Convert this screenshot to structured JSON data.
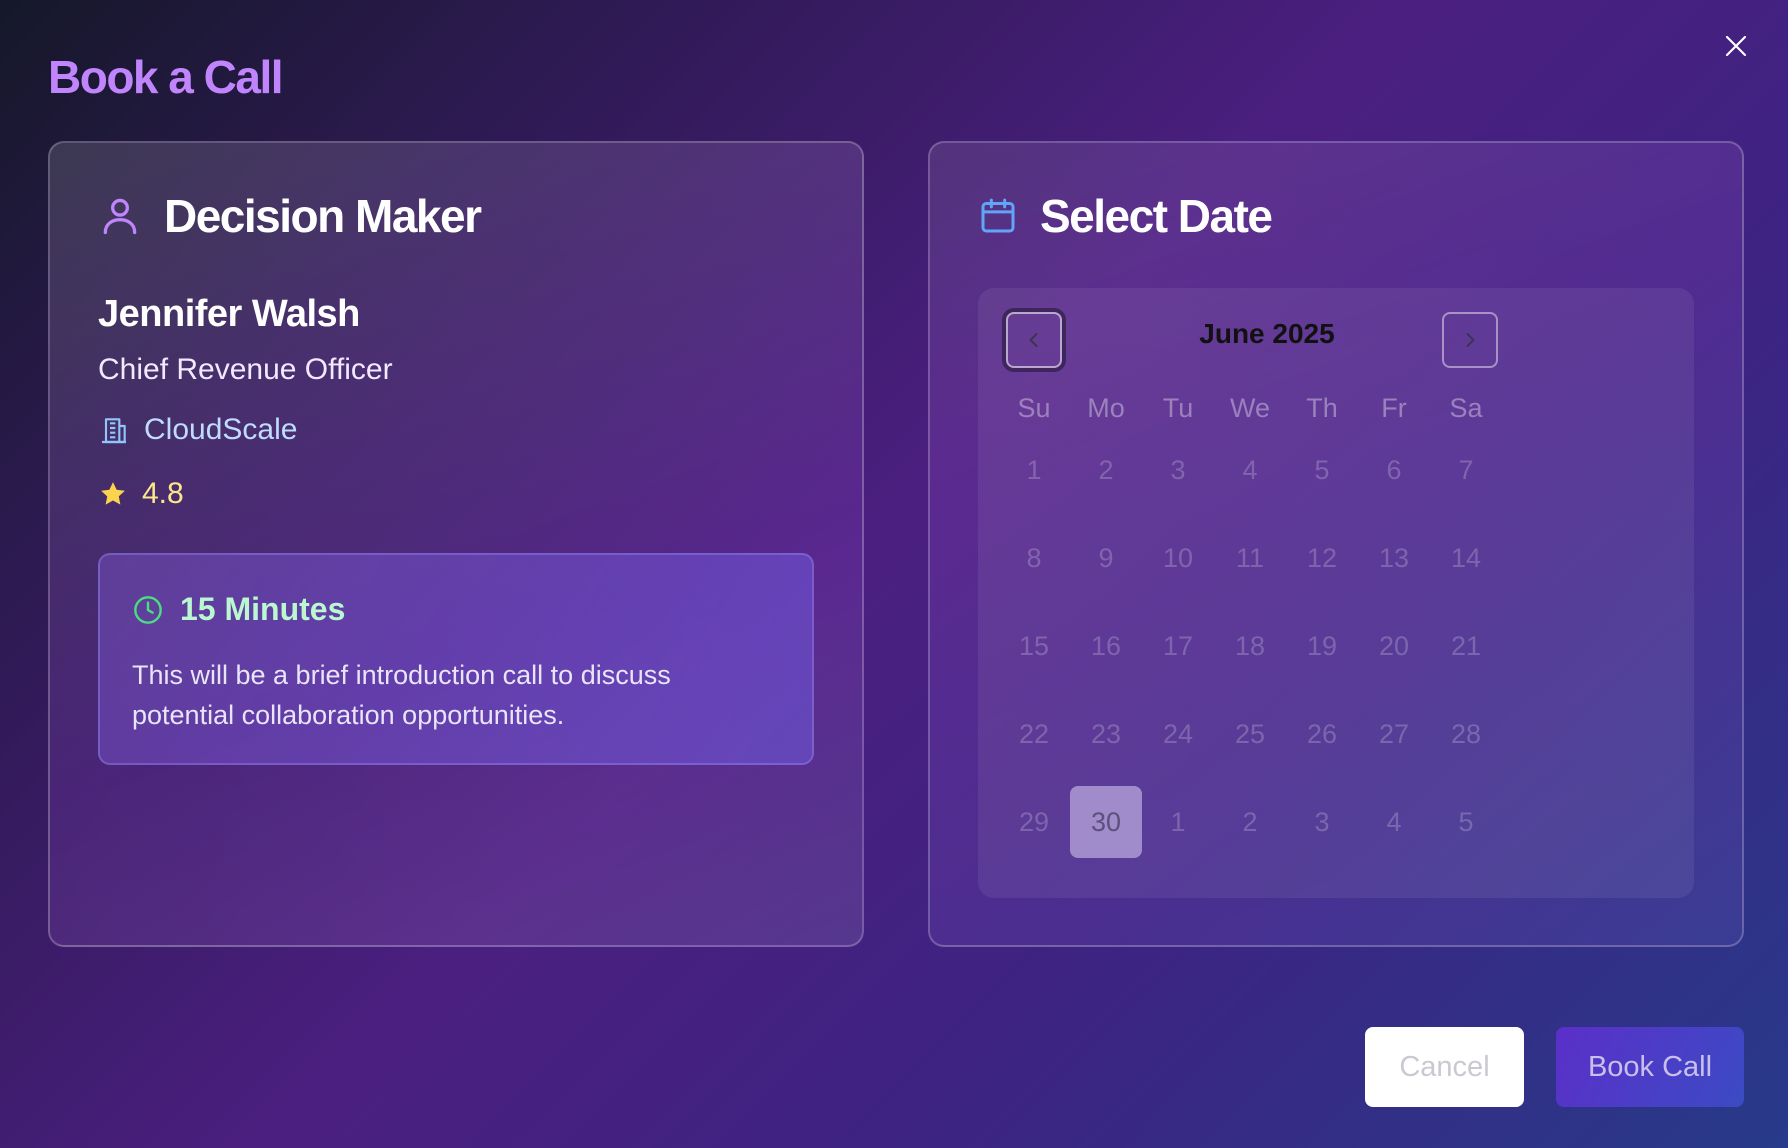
{
  "modal": {
    "title": "Book a Call"
  },
  "decision_maker": {
    "heading": "Decision Maker",
    "name": "Jennifer Walsh",
    "role": "Chief Revenue Officer",
    "company": "CloudScale",
    "rating": "4.8",
    "call": {
      "duration": "15 Minutes",
      "description": "This will be a brief introduction call to discuss potential collaboration opportunities."
    }
  },
  "date_picker": {
    "heading": "Select Date",
    "month_label": "June 2025",
    "weekdays": [
      "Su",
      "Mo",
      "Tu",
      "We",
      "Th",
      "Fr",
      "Sa"
    ],
    "weeks": [
      [
        "1",
        "2",
        "3",
        "4",
        "5",
        "6",
        "7"
      ],
      [
        "8",
        "9",
        "10",
        "11",
        "12",
        "13",
        "14"
      ],
      [
        "15",
        "16",
        "17",
        "18",
        "19",
        "20",
        "21"
      ],
      [
        "22",
        "23",
        "24",
        "25",
        "26",
        "27",
        "28"
      ],
      [
        "29",
        "30",
        "1",
        "2",
        "3",
        "4",
        "5"
      ]
    ],
    "selected_day": "30"
  },
  "actions": {
    "cancel": "Cancel",
    "book": "Book Call"
  },
  "icons": {
    "close": "close-icon",
    "user": "user-icon",
    "calendar": "calendar-icon",
    "building": "building-icon",
    "star": "star-icon",
    "clock": "clock-icon",
    "prev": "chevron-left-icon",
    "next": "chevron-right-icon"
  },
  "colors": {
    "title_accent": "#c084fc",
    "user_icon": "#c084fc",
    "calendar_icon": "#60a5fa",
    "company_text": "#bfdbfe",
    "rating_text": "#fde68a",
    "star_icon": "#fcd34d",
    "duration_text": "#bbf7d0",
    "clock_icon": "#4ade80"
  }
}
